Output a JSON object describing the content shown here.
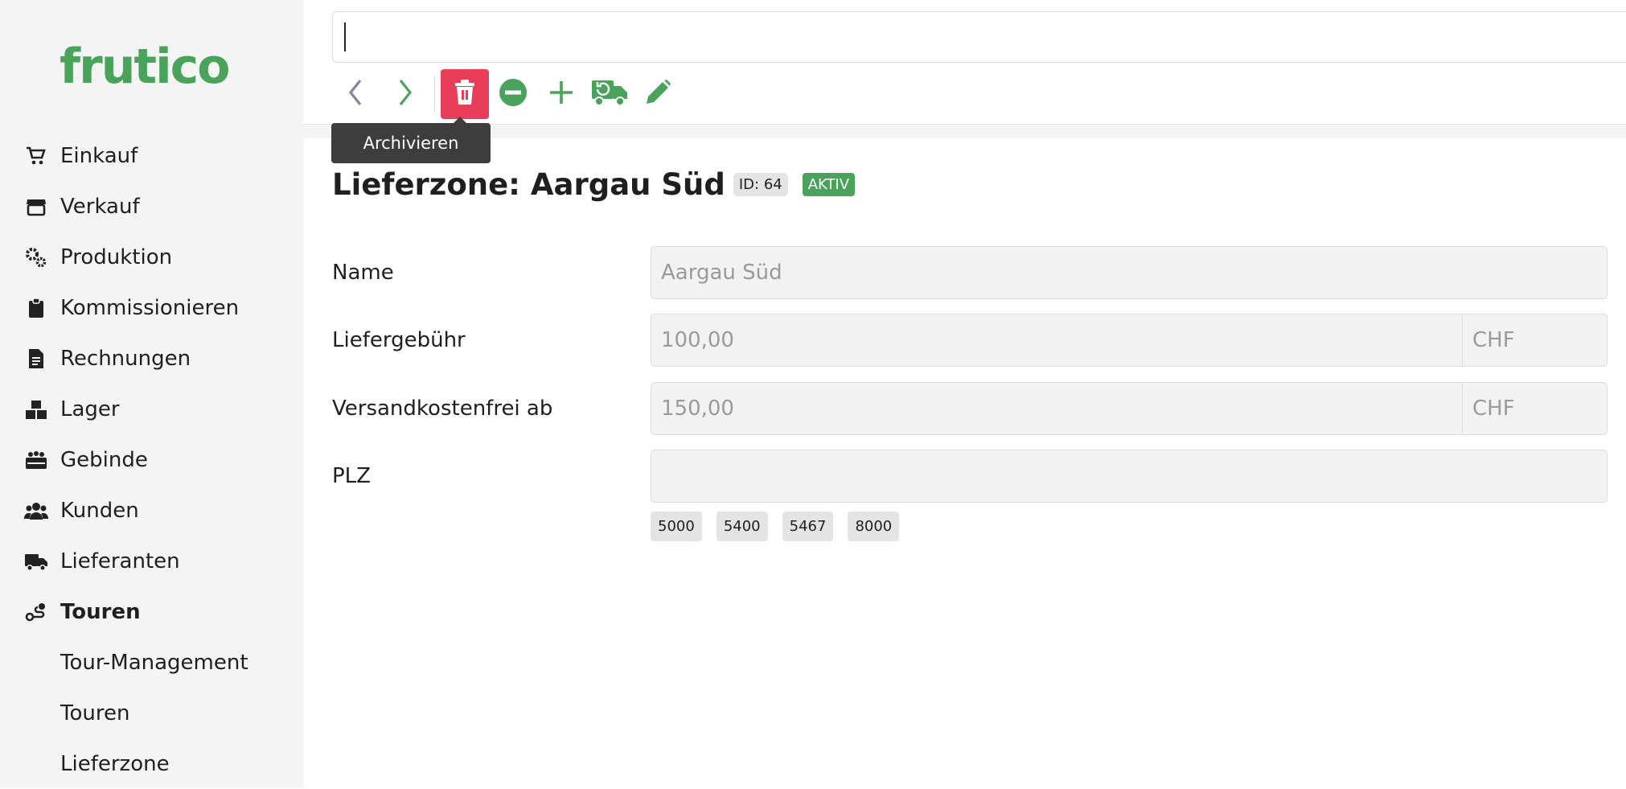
{
  "app": {
    "logo": "frutico"
  },
  "sidebar": {
    "items": [
      {
        "label": "Einkauf",
        "icon": "cart-icon"
      },
      {
        "label": "Verkauf",
        "icon": "store-icon"
      },
      {
        "label": "Produktion",
        "icon": "gears-icon"
      },
      {
        "label": "Kommissionieren",
        "icon": "clipboard-icon"
      },
      {
        "label": "Rechnungen",
        "icon": "invoice-icon"
      },
      {
        "label": "Lager",
        "icon": "boxes-icon"
      },
      {
        "label": "Gebinde",
        "icon": "crate-icon"
      },
      {
        "label": "Kunden",
        "icon": "users-icon"
      },
      {
        "label": "Lieferanten",
        "icon": "truck-icon"
      },
      {
        "label": "Touren",
        "icon": "route-icon",
        "active": true
      }
    ],
    "subitems": [
      {
        "label": "Tour-Management"
      },
      {
        "label": "Touren"
      },
      {
        "label": "Lieferzone"
      }
    ]
  },
  "toolbar": {
    "tooltip": "Archivieren",
    "icons": [
      "chevron-left-icon",
      "chevron-right-icon",
      "trash-icon",
      "minus-circle-icon",
      "plus-icon",
      "truck-restore-icon",
      "pencil-icon"
    ]
  },
  "page": {
    "title": "Lieferzone: Aargau Süd",
    "id_badge": "ID: 64",
    "status_badge": "AKTIV"
  },
  "form": {
    "name": {
      "label": "Name",
      "value": "Aargau Süd"
    },
    "fee": {
      "label": "Liefergebühr",
      "value": "100,00",
      "currency": "CHF"
    },
    "free_from": {
      "label": "Versandkostenfrei ab",
      "value": "150,00",
      "currency": "CHF"
    },
    "plz": {
      "label": "PLZ",
      "value": "",
      "tags": [
        "5000",
        "5400",
        "5467",
        "8000"
      ]
    }
  },
  "colors": {
    "brand": "#4aa35a",
    "danger": "#e83e5a",
    "sidebar_bg": "#f4f4f4"
  }
}
